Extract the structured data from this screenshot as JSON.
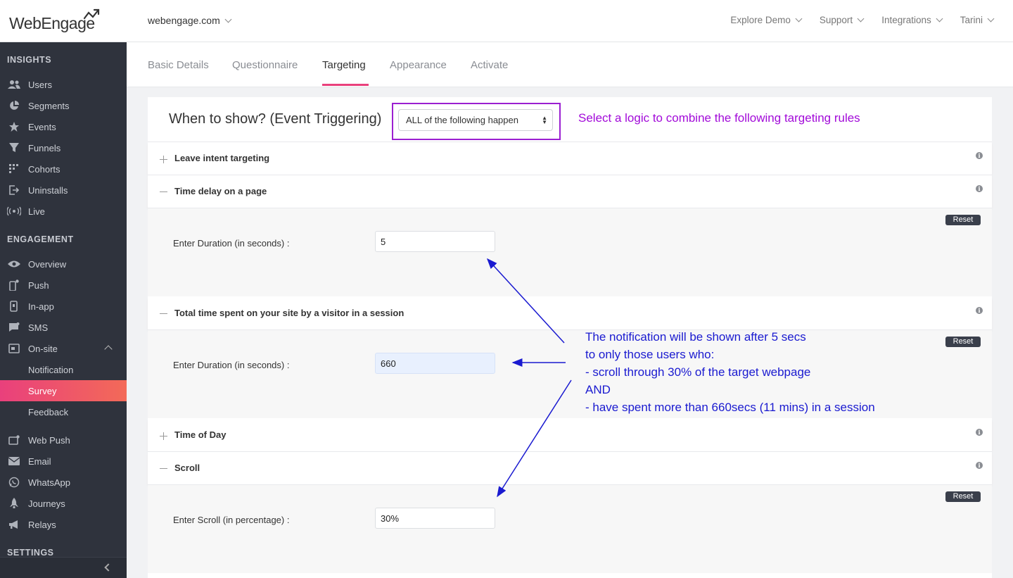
{
  "brand": {
    "logo_text": "WebEngage"
  },
  "header": {
    "account": "webengage.com",
    "nav": [
      "Explore Demo",
      "Support",
      "Integrations",
      "Tarini"
    ]
  },
  "sidebar": {
    "sections": {
      "insights": "INSIGHTS",
      "engagement": "ENGAGEMENT",
      "settings": "SETTINGS"
    },
    "insights_items": [
      {
        "label": "Users",
        "icon": "users-icon"
      },
      {
        "label": "Segments",
        "icon": "pie-chart-icon"
      },
      {
        "label": "Events",
        "icon": "star-icon"
      },
      {
        "label": "Funnels",
        "icon": "funnel-icon"
      },
      {
        "label": "Cohorts",
        "icon": "grid-icon"
      },
      {
        "label": "Uninstalls",
        "icon": "exit-icon"
      },
      {
        "label": "Live",
        "icon": "broadcast-icon"
      }
    ],
    "engagement_items": [
      {
        "label": "Overview",
        "icon": "eye-icon"
      },
      {
        "label": "Push",
        "icon": "mobile-push-icon"
      },
      {
        "label": "In-app",
        "icon": "mobile-icon"
      },
      {
        "label": "SMS",
        "icon": "chat-icon"
      },
      {
        "label": "On-site",
        "icon": "window-icon"
      },
      {
        "label": "Notification"
      },
      {
        "label": "Survey"
      },
      {
        "label": "Feedback"
      },
      {
        "label": "Web Push",
        "icon": "browser-icon"
      },
      {
        "label": "Email",
        "icon": "envelope-icon"
      },
      {
        "label": "WhatsApp",
        "icon": "whatsapp-icon"
      },
      {
        "label": "Journeys",
        "icon": "rocket-icon"
      },
      {
        "label": "Relays",
        "icon": "megaphone-icon"
      }
    ]
  },
  "tabs": [
    "Basic Details",
    "Questionnaire",
    "Targeting",
    "Appearance",
    "Activate"
  ],
  "targeting": {
    "heading": "When to show? (Event Triggering)",
    "logic_value": "ALL of the following happen",
    "rules": {
      "leave_intent": "Leave intent targeting",
      "time_delay": "Time delay on a page",
      "total_time": "Total time spent on your site by a visitor in a session",
      "time_of_day": "Time of Day",
      "scroll": "Scroll"
    },
    "fields": {
      "duration_label": "Enter Duration (in seconds) :",
      "time_delay_value": "5",
      "total_time_value": "660",
      "scroll_label": "Enter Scroll (in percentage) :",
      "scroll_value": "30%"
    },
    "reset_label": "Reset",
    "info_glyph": "i"
  },
  "annotations": {
    "logic_note": "Select a logic to combine the following targeting rules",
    "main_note": [
      "The notification will be shown after 5 secs",
      "to only those users who:",
      "- scroll through 30% of the target webpage",
      "AND",
      "- have spent more than 660secs (11 mins) in a session"
    ]
  },
  "colors": {
    "sidebar_bg": "#2f333d",
    "active_gradient_start": "#e9407c",
    "active_gradient_end": "#f36a58",
    "annotation_purple": "#a20ad9",
    "annotation_blue": "#1a1ad0"
  }
}
